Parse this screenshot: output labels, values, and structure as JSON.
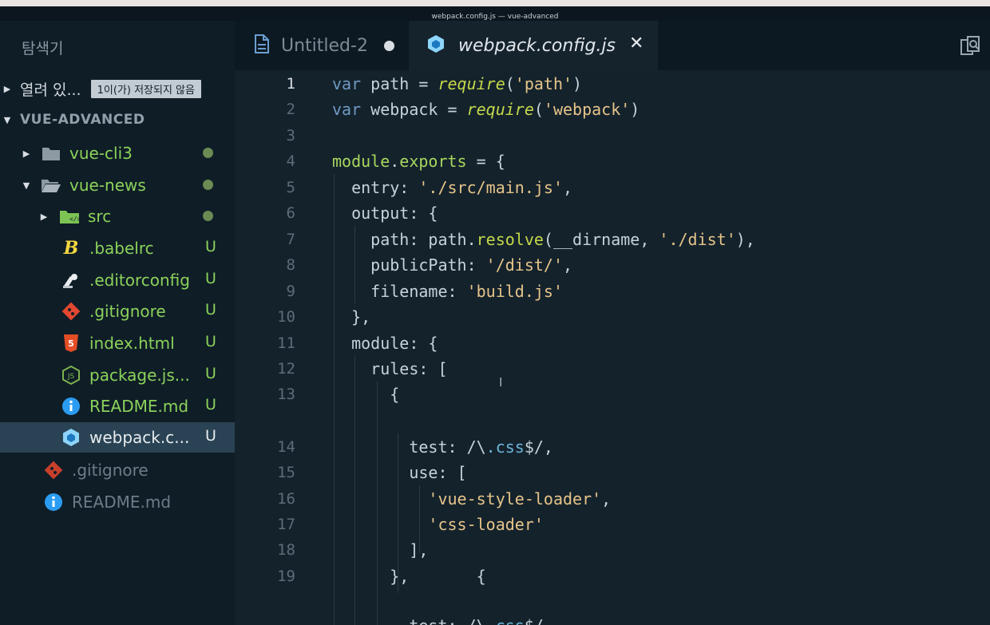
{
  "window": {
    "title": "webpack.config.js — vue-advanced"
  },
  "sidebar": {
    "title": "탐색기",
    "open_editors": {
      "label": "열려 있...",
      "badge": "1이(가) 저장되지 않음"
    },
    "project": {
      "label": "VUE-ADVANCED"
    },
    "items": [
      {
        "name": "vue-cli3",
        "status": ""
      },
      {
        "name": "vue-news",
        "status": ""
      },
      {
        "name": "src",
        "status": ""
      },
      {
        "name": ".babelrc",
        "status": "U"
      },
      {
        "name": ".editorconfig",
        "status": "U"
      },
      {
        "name": ".gitignore",
        "status": "U"
      },
      {
        "name": "index.html",
        "status": "U"
      },
      {
        "name": "package.js...",
        "status": "U"
      },
      {
        "name": "README.md",
        "status": "U"
      },
      {
        "name": "webpack.c...",
        "status": "U"
      },
      {
        "name": ".gitignore",
        "status": ""
      },
      {
        "name": "README.md",
        "status": ""
      }
    ]
  },
  "tabs": [
    {
      "label": "Untitled-2"
    },
    {
      "label": "webpack.config.js"
    }
  ],
  "editor": {
    "line_numbers": [
      "1",
      "2",
      "3",
      "4",
      "5",
      "6",
      "7",
      "8",
      "9",
      "10",
      "11",
      "12",
      "13",
      "14",
      "15",
      "16",
      "17",
      "18",
      "19"
    ]
  },
  "colors": {
    "accent_green": "#8bd25a",
    "selection": "#2a4354",
    "string": "#e6c58a"
  }
}
